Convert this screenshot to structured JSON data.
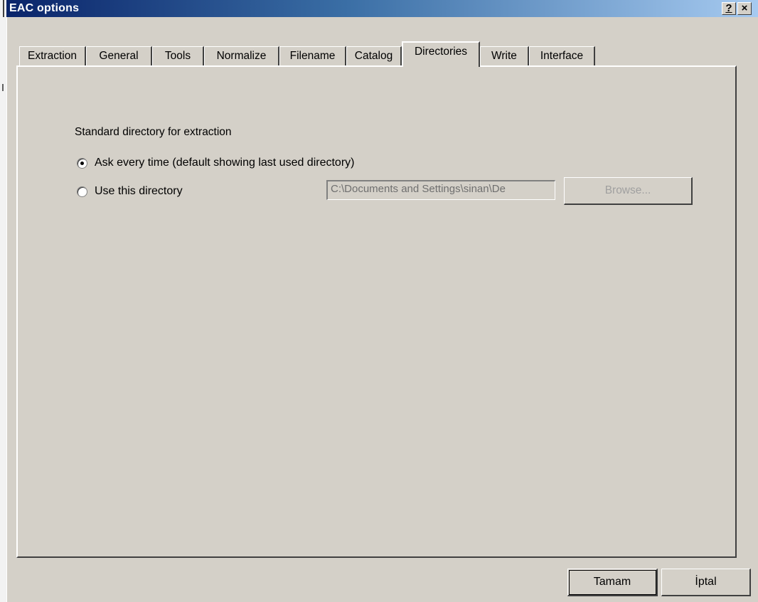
{
  "window": {
    "title": "EAC options",
    "help_label": "?",
    "close_label": "×"
  },
  "tabs": [
    {
      "label": "Extraction"
    },
    {
      "label": "General"
    },
    {
      "label": "Tools"
    },
    {
      "label": "Normalize"
    },
    {
      "label": "Filename"
    },
    {
      "label": "Catalog"
    },
    {
      "label": "Directories",
      "active": true
    },
    {
      "label": "Write"
    },
    {
      "label": "Interface"
    }
  ],
  "directories": {
    "group_label": "Standard directory for extraction",
    "option_ask": {
      "label": "Ask every time (default showing last used directory)",
      "checked": true
    },
    "option_use": {
      "label": "Use this directory",
      "checked": false
    },
    "path_value": "C:\\Documents and Settings\\sinan\\De",
    "browse_label": "Browse..."
  },
  "footer": {
    "ok_label": "Tamam",
    "cancel_label": "İptal"
  }
}
